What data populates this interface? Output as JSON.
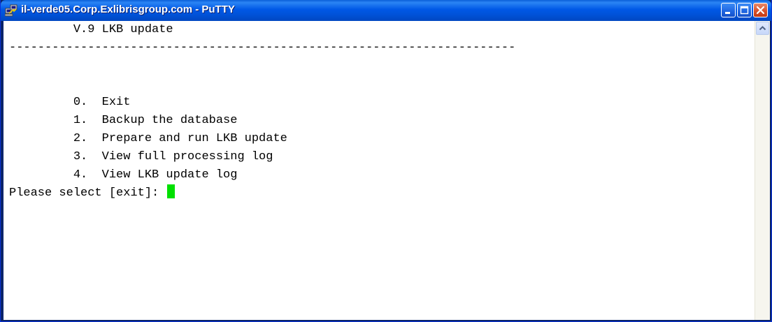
{
  "window": {
    "title": "il-verde05.Corp.Exlibrisgroup.com - PuTTY"
  },
  "icons": {
    "app": "putty-icon",
    "minimize": "minimize-icon",
    "maximize": "maximize-icon",
    "close": "close-icon",
    "scroll_up": "scroll-up-arrow-icon"
  },
  "colors": {
    "titlebar": "#0058e6",
    "close_button": "#d9532c",
    "cursor": "#00e000",
    "terminal_bg": "#ffffff",
    "terminal_fg": "#000000"
  },
  "terminal": {
    "heading": "         V.9 LKB update",
    "separator": "-----------------------------------------------------------------------",
    "menu": [
      "         0.  Exit",
      "         1.  Backup the database",
      "         2.  Prepare and run LKB update",
      "         3.  View full processing log",
      "         4.  View LKB update log"
    ],
    "prompt": "Please select [exit]: "
  }
}
